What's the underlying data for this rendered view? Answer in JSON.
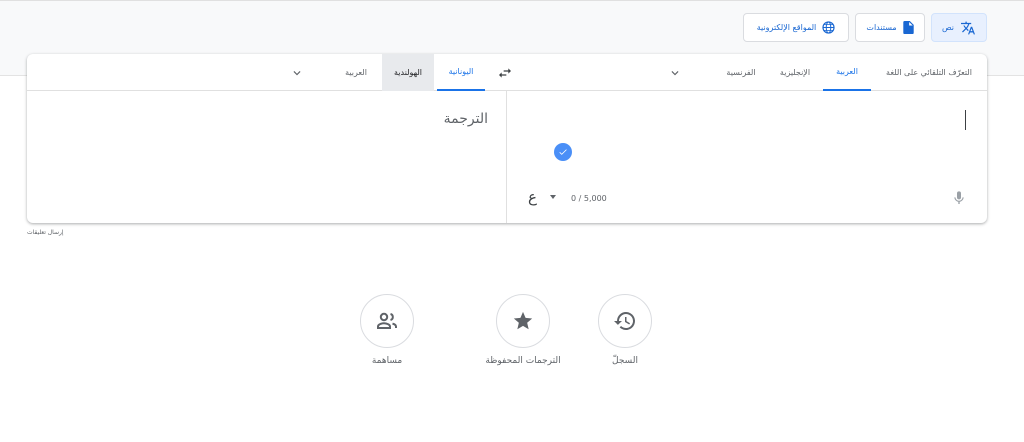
{
  "modes": [
    {
      "label": "نص",
      "icon": "translate-icon",
      "active": true
    },
    {
      "label": "مستندات",
      "icon": "document-icon",
      "active": false
    },
    {
      "label": "المواقع الإلكترونية",
      "icon": "globe-icon",
      "active": false
    }
  ],
  "source_langs": {
    "detect": "التعرّف التلقائي على اللغة",
    "arabic": "العربية",
    "english": "الإنجليزية",
    "french": "الفرنسية"
  },
  "target_langs": {
    "greek": "اليونانية",
    "dutch": "الهولندية",
    "arabic": "العربية"
  },
  "source": {
    "char_count": "0 / 5,000",
    "keyboard_glyph": "ع"
  },
  "target": {
    "placeholder": "الترجمة"
  },
  "feedback": "إرسال تعليقات",
  "shortcuts": {
    "history": "السجلّ",
    "saved": "الترجمات المحفوظة",
    "contribute": "مساهمة"
  },
  "colors": {
    "accent": "#1a73e8",
    "check": "#4a8ff7"
  }
}
